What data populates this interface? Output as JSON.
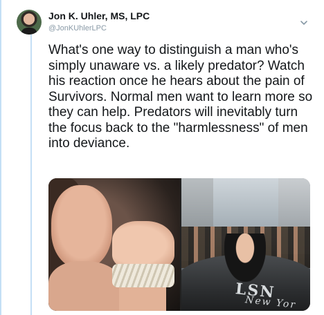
{
  "tweet": {
    "author": {
      "display_name": "Jon K. Uhler, MS, LPC",
      "handle": "@JonKUhlerLPC"
    },
    "text": "What's one way to distinguish a man who's simply unaware vs. a likely predator? Watch his reaction once he hears about the pain of Survivors. Normal men want to learn more so they can help. Predators will inevitably turn the focus back to the \"harmlessness\" of men into deviance.",
    "menu_icon": "chevron-down-icon",
    "media": {
      "count": 2,
      "right_photo_text": {
        "logo": "LSN",
        "city": "New Yor"
      }
    }
  },
  "colors": {
    "name": "#14171a",
    "handle": "#8899a6",
    "thread_line": "#c4dff5"
  }
}
